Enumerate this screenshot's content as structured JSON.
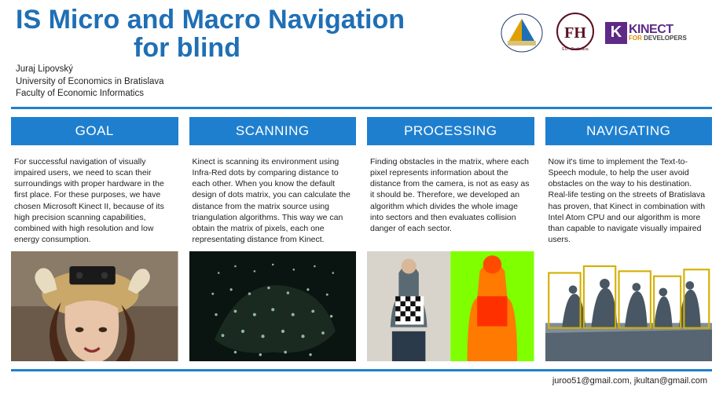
{
  "title_line1": "IS Micro and Macro Navigation",
  "title_line2": "for blind",
  "author": {
    "name": "Juraj Lipovský",
    "affiliation1": "University of Economics in Bratislava",
    "affiliation2": "Faculty of Economic Informatics"
  },
  "logos": {
    "euba_alt": "Ekonomická Univerzita v Bratislave",
    "fhi_alt": "Fakulta hospodárskej informatiky EU Bratislava",
    "kinect_brand": "KINECT",
    "kinect_sub_for": "FOR",
    "kinect_sub_dev": " DEVELOPERS"
  },
  "columns": [
    {
      "heading": "GOAL",
      "body": "For successful navigation of visually impaired users, we need to scan their surroundings with proper hardware in the first place. For these purposes, we have chosen Microsoft Kinect II, because of its high precision scanning capabilities, combined with high resolution and low energy consumption.",
      "image_alt": "Person wearing horned helmet with Kinect sensor mounted on top"
    },
    {
      "heading": "SCANNING",
      "body": "Kinect is scanning its environment using Infra-Red dots by comparing distance to each other. When you know the default design of dots matrix, you can calculate the distance from the matrix source using triangulation algorithms. This way we can obtain the matrix of pixels, each one representating distance from Kinect.",
      "image_alt": "Infra-red dot pattern projected on a hand"
    },
    {
      "heading": "PROCESSING",
      "body": "Finding obstacles in the matrix, where each pixel represents information about the distance from the camera, is not as easy as it should be. Therefore, we developed an algorithm which divides the whole image into sectors and then evaluates collision danger of each sector.",
      "image_alt": "Man holding checkerboard next to orange silhouette on green depth map"
    },
    {
      "heading": "NAVIGATING",
      "body": "Now it's time to implement the Text-to-Speech module, to help the user avoid obstacles on the way to his destination. Real-life testing on the streets of Bratislava has proven, that Kinect in combination with Intel Atom CPU and our algorithm is more than capable to navigate visually impaired users.",
      "image_alt": "Depth map of street scene with people silhouettes and yellow sector grid"
    }
  ],
  "footer_contacts": "juroo51@gmail.com, jkultan@gmail.com"
}
